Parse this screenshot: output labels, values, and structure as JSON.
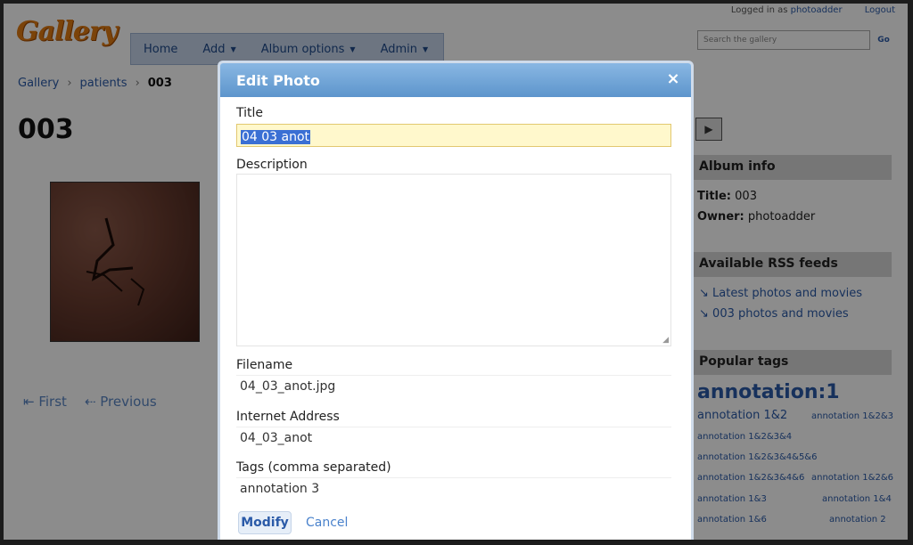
{
  "app": {
    "logo_text": "Gallery"
  },
  "login": {
    "prefix": "Logged in as",
    "username": "photoadder",
    "logout": "Logout"
  },
  "search": {
    "placeholder": "Search the gallery",
    "go": "Go"
  },
  "menu": [
    {
      "label": "Home",
      "has_caret": false
    },
    {
      "label": "Add",
      "has_caret": true
    },
    {
      "label": "Album options",
      "has_caret": true
    },
    {
      "label": "Admin",
      "has_caret": true
    }
  ],
  "breadcrumb": {
    "items": [
      "Gallery",
      "patients"
    ],
    "current": "003"
  },
  "page": {
    "title": "003"
  },
  "pager": {
    "first": "First",
    "previous": "Previous"
  },
  "sidebar": {
    "album_info_title": "Album info",
    "title_label": "Title:",
    "title_value": "003",
    "owner_label": "Owner:",
    "owner_value": "photoadder",
    "rss_title": "Available RSS feeds",
    "rss_links": [
      "Latest photos and movies",
      "003 photos and movies"
    ],
    "tags_title": "Popular tags",
    "tags": [
      "annotation:1",
      "annotation 1&2",
      "annotation 1&2&3",
      "annotation 1&2&3&4",
      "annotation 1&2&3&4&5&6",
      "annotation 1&2&3&4&6",
      "annotation 1&2&6",
      "annotation 1&3",
      "annotation 1&4",
      "annotation 1&6",
      "annotation 2"
    ]
  },
  "dialog": {
    "title": "Edit Photo",
    "close_glyph": "×",
    "fields": {
      "title_label": "Title",
      "title_value": "04 03 anot",
      "description_label": "Description",
      "description_value": "",
      "filename_label": "Filename",
      "filename_value": "04_03_anot.jpg",
      "internet_address_label": "Internet Address",
      "internet_address_value": "04_03_anot",
      "tags_label": "Tags (comma separated)",
      "tags_value": "annotation 3"
    },
    "modify_label": "Modify",
    "cancel_label": "Cancel"
  },
  "colors": {
    "dialog_header": "#5d95cc",
    "title_highlight": "#fff8cc",
    "selection": "#3a6fd4",
    "link": "#2a5aa8",
    "logo": "#e07a12"
  },
  "icons": {
    "close": "close-icon",
    "rss": "rss-icon",
    "resize": "resize-grip-icon",
    "slideshow": "slideshow-icon"
  }
}
